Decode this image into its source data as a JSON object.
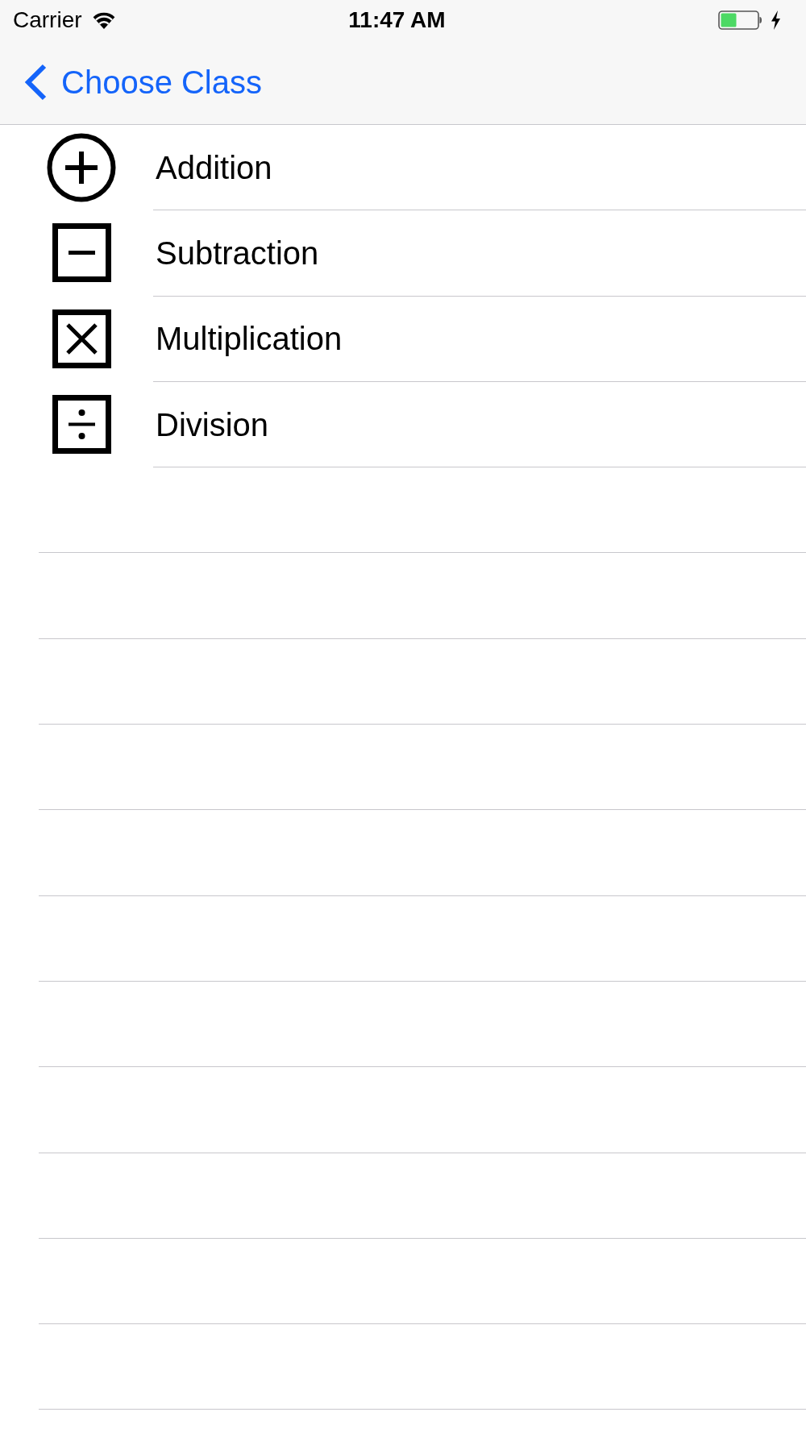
{
  "status_bar": {
    "carrier": "Carrier",
    "time": "11:47 AM"
  },
  "nav_bar": {
    "back_label": "Choose Class"
  },
  "list": {
    "rows": [
      {
        "label": "Addition",
        "kind": "plus"
      },
      {
        "label": "Subtraction",
        "kind": "minus"
      },
      {
        "label": "Multiplication",
        "kind": "times"
      },
      {
        "label": "Division",
        "kind": "divide"
      }
    ]
  }
}
